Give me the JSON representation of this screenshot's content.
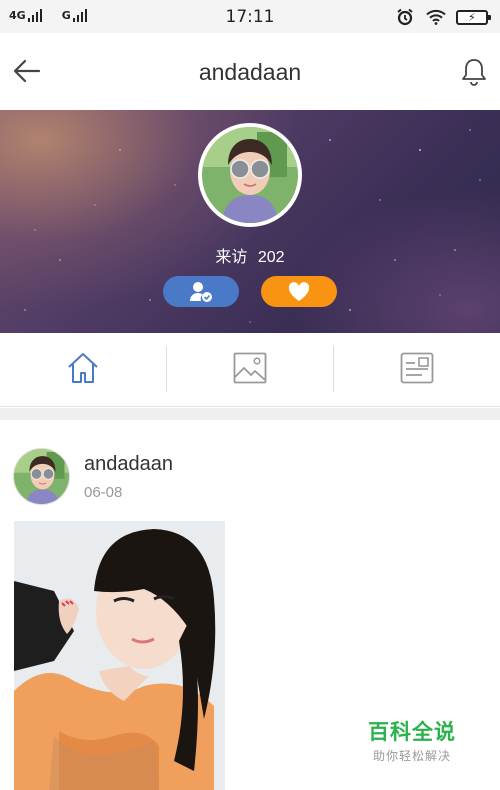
{
  "status_bar": {
    "network_1": "4G",
    "network_2": "G",
    "time": "17:11"
  },
  "header": {
    "title": "andadaan"
  },
  "profile": {
    "visits_label": "来访",
    "visits_count": "202"
  },
  "tabs": [
    {
      "icon": "home-icon",
      "selected": true
    },
    {
      "icon": "image-icon",
      "selected": false
    },
    {
      "icon": "card-icon",
      "selected": false
    }
  ],
  "post": {
    "author": "andadaan",
    "date": "06-08"
  },
  "watermark": {
    "title": "百科全说",
    "subtitle": "助你轻松解决"
  },
  "colors": {
    "follow_button": "#4a79c8",
    "like_button": "#f99312",
    "active_tab_icon": "#4a79c8",
    "inactive_tab_icon": "#9a9a9a",
    "watermark": "#2bb24c"
  }
}
